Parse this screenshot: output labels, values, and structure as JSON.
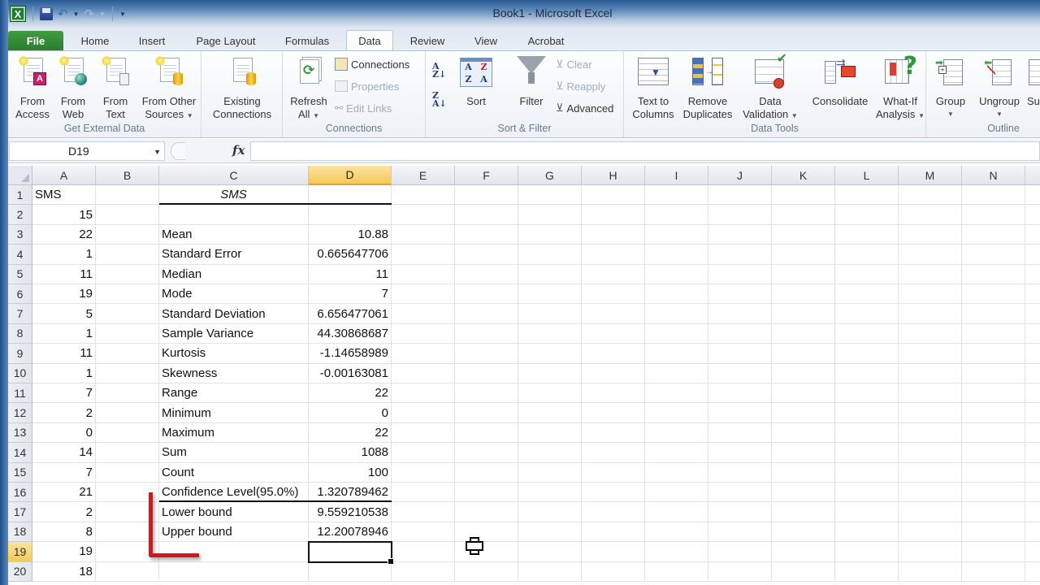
{
  "window": {
    "title": "Book1  -  Microsoft Excel",
    "app_icon": "excel-icon",
    "quick_access": [
      "save-icon",
      "undo-icon",
      "redo-icon",
      "customize-qat-icon"
    ]
  },
  "ribbon": {
    "tabs": [
      {
        "label": "File"
      },
      {
        "label": "Home"
      },
      {
        "label": "Insert"
      },
      {
        "label": "Page Layout"
      },
      {
        "label": "Formulas"
      },
      {
        "label": "Data",
        "active": true
      },
      {
        "label": "Review"
      },
      {
        "label": "View"
      },
      {
        "label": "Acrobat"
      }
    ],
    "groups": {
      "get_external_data": {
        "label": "Get External Data",
        "buttons": [
          {
            "line1": "From",
            "line2": "Access"
          },
          {
            "line1": "From",
            "line2": "Web"
          },
          {
            "line1": "From",
            "line2": "Text"
          },
          {
            "line1": "From Other",
            "line2": "Sources"
          },
          {
            "line1": "Existing",
            "line2": "Connections"
          }
        ]
      },
      "connections": {
        "label": "Connections",
        "refresh": {
          "line1": "Refresh",
          "line2": "All"
        },
        "small": [
          "Connections",
          "Properties",
          "Edit Links"
        ]
      },
      "sort_filter": {
        "label": "Sort & Filter",
        "sort": "Sort",
        "filter": "Filter",
        "small": [
          "Clear",
          "Reapply",
          "Advanced"
        ]
      },
      "data_tools": {
        "label": "Data Tools",
        "buttons": [
          {
            "line1": "Text to",
            "line2": "Columns"
          },
          {
            "line1": "Remove",
            "line2": "Duplicates"
          },
          {
            "line1": "Data",
            "line2": "Validation"
          },
          {
            "line1": "Consolidate",
            "line2": ""
          },
          {
            "line1": "What-If",
            "line2": "Analysis"
          }
        ]
      },
      "outline": {
        "label": "Outline",
        "buttons": [
          {
            "line1": "Group"
          },
          {
            "line1": "Ungroup"
          },
          {
            "line1": "Su"
          }
        ]
      }
    }
  },
  "formula_bar": {
    "name_box": "D19",
    "fx": "fx",
    "formula": ""
  },
  "sheet": {
    "columns": [
      "A",
      "B",
      "C",
      "D",
      "E",
      "F",
      "G",
      "H",
      "I",
      "J",
      "K",
      "L",
      "M",
      "N"
    ],
    "selected_column": "D",
    "selected_row": 19,
    "rows": [
      {
        "n": "1",
        "A": "SMS",
        "C": "SMS",
        "D": ""
      },
      {
        "n": "2",
        "A": "15",
        "C": "",
        "D": ""
      },
      {
        "n": "3",
        "A": "22",
        "C": "Mean",
        "D": "10.88"
      },
      {
        "n": "4",
        "A": "1",
        "C": "Standard Error",
        "D": "0.665647706"
      },
      {
        "n": "5",
        "A": "11",
        "C": "Median",
        "D": "11"
      },
      {
        "n": "6",
        "A": "19",
        "C": "Mode",
        "D": "7"
      },
      {
        "n": "7",
        "A": "5",
        "C": "Standard Deviation",
        "D": "6.656477061"
      },
      {
        "n": "8",
        "A": "1",
        "C": "Sample Variance",
        "D": "44.30868687"
      },
      {
        "n": "9",
        "A": "11",
        "C": "Kurtosis",
        "D": "-1.14658989"
      },
      {
        "n": "10",
        "A": "1",
        "C": "Skewness",
        "D": "-0.00163081"
      },
      {
        "n": "11",
        "A": "7",
        "C": "Range",
        "D": "22"
      },
      {
        "n": "12",
        "A": "2",
        "C": "Minimum",
        "D": "0"
      },
      {
        "n": "13",
        "A": "0",
        "C": "Maximum",
        "D": "22"
      },
      {
        "n": "14",
        "A": "14",
        "C": "Sum",
        "D": "1088"
      },
      {
        "n": "15",
        "A": "7",
        "C": "Count",
        "D": "100"
      },
      {
        "n": "16",
        "A": "21",
        "C": "Confidence Level(95.0%)",
        "D": "1.320789462"
      },
      {
        "n": "17",
        "A": "2",
        "C": "Lower bound",
        "D": "9.559210538"
      },
      {
        "n": "18",
        "A": "8",
        "C": "Upper bound",
        "D": "12.20078946"
      },
      {
        "n": "19",
        "A": "19",
        "C": "",
        "D": ""
      },
      {
        "n": "20",
        "A": "18",
        "C": "",
        "D": ""
      }
    ]
  },
  "annotation": {
    "color": "#d9141b",
    "shape": "red-l-bracket"
  },
  "colors": {
    "file_tab": "#2b7e2d",
    "selection_header": "#f5c95a",
    "title_bar": "#2a5a93"
  }
}
